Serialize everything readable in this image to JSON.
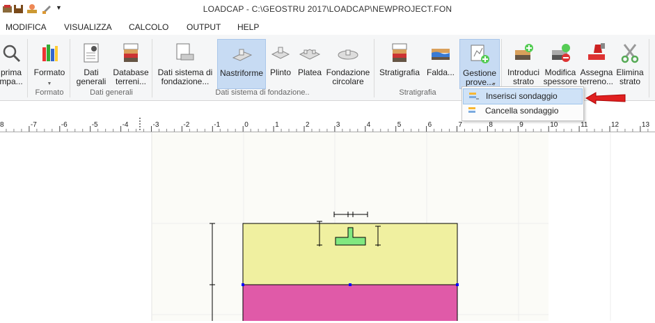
{
  "window": {
    "title": "LOADCAP  - C:\\GEOSTRU 2017\\LOADCAP\\NEWPROJECT.FON"
  },
  "menu": [
    "MODIFICA",
    "VISUALIZZA",
    "CALCOLO",
    "OUTPUT",
    "HELP"
  ],
  "ribbon": {
    "stampa_label": "prima\nmpa...",
    "formato_label": "Formato",
    "dati_generali_label": "Dati\ngenerali",
    "database_label": "Database\nterreni...",
    "dati_sistema_label": "Dati sistema di\nfondazione...",
    "nastriforme_label": "Nastriforme",
    "plinto_label": "Plinto",
    "platea_label": "Platea",
    "circolare_label": "Fondazione\ncircolare",
    "stratigrafia_label": "Stratigrafia",
    "falda_label": "Falda...",
    "gestione_label": "Gestione\nprove...",
    "introduci_label": "Introduci\nstrato",
    "modifica_label": "Modifica\nspessore",
    "assegna_label": "Assegna\nterreno...",
    "elimina_label": "Elimina\nstrato",
    "groups": {
      "formato": "Formato",
      "dati_generali": "Dati generali",
      "dati_sistema": "Dati sistema di fondazione..",
      "stratigrafia": "Stratigrafia"
    }
  },
  "dropdown": {
    "items": [
      "Inserisci sondaggio",
      "Cancella sondaggio"
    ]
  },
  "ruler": {
    "labels": [
      "8",
      "-7",
      "-6",
      "-5",
      "-4",
      "-3",
      "-2",
      "-1",
      "0",
      "1",
      "2",
      "3",
      "4",
      "5",
      "6",
      "7",
      "8",
      "9",
      "10",
      "11",
      "12",
      "13"
    ]
  },
  "colors": {
    "ribbon_bg": "#f5f6f7",
    "selected": "#c7dbf3",
    "layer_top": "#f0f0a0",
    "layer_bottom": "#e05aa8",
    "foundation": "#80e880",
    "arrow": "#e02020"
  }
}
